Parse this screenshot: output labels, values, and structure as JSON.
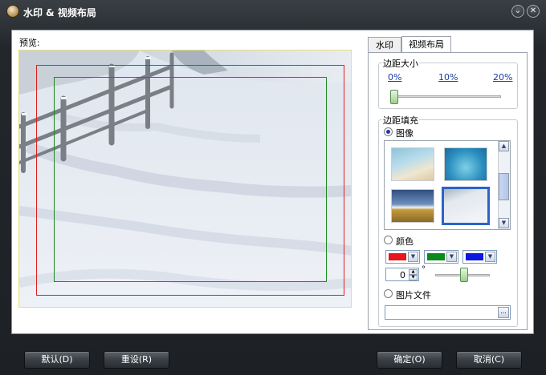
{
  "window": {
    "title": "水印 & 视频布局",
    "minimize_glyph": "⌄",
    "close_glyph": "✕"
  },
  "preview": {
    "label": "预览:"
  },
  "tabs": [
    {
      "label": "水印",
      "active": false
    },
    {
      "label": "视频布局",
      "active": true
    }
  ],
  "margin_size": {
    "title": "边距大小",
    "ticks": [
      "0%",
      "10%",
      "20%"
    ],
    "value_percent": 0
  },
  "margin_fill": {
    "title": "边距填充",
    "image_option": {
      "label": "图像",
      "selected": true
    },
    "images": [
      "beach-sand",
      "blue-water",
      "wheat-field-sky",
      "snow-fence"
    ],
    "selected_image": 3,
    "color_option": {
      "label": "颜色",
      "selected": false
    },
    "colors": [
      {
        "name": "red",
        "hex": "#e8141e"
      },
      {
        "name": "green",
        "hex": "#0a8a1a"
      },
      {
        "name": "blue",
        "hex": "#0a18e0"
      }
    ],
    "angle": {
      "value": "0",
      "unit": "°",
      "slider_fraction": 0.5
    },
    "picture_file_option": {
      "label": "图片文件",
      "selected": false
    },
    "file_path": "",
    "browse_label": "..."
  },
  "buttons": {
    "default": "默认(D)",
    "reset": "重设(R)",
    "ok": "确定(O)",
    "cancel": "取消(C)"
  }
}
